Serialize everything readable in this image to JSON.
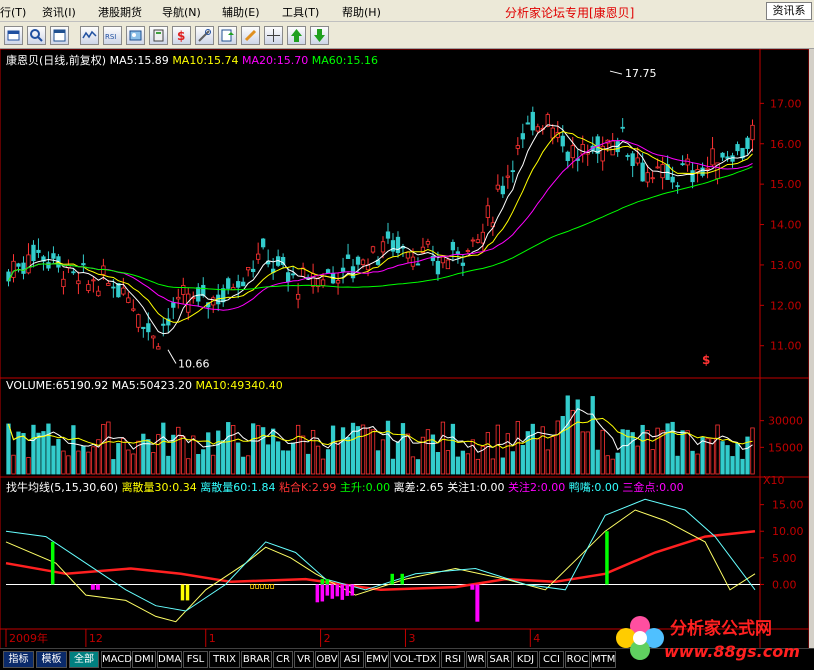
{
  "menu": {
    "items": [
      "行(T)",
      "资讯(I)",
      "港股期货",
      "导航(N)",
      "辅助(E)",
      "工具(T)",
      "帮助(H)"
    ],
    "brand": "分析家论坛专用[康恩贝]",
    "info_button": "资讯系"
  },
  "colors": {
    "up": "#ff3333",
    "down": "#33cccc",
    "ma5": "#ffffff",
    "ma10": "#ffff00",
    "ma20": "#ff00ff",
    "ma60": "#00ff00"
  },
  "price_panel": {
    "title": "康恩贝(日线,前复权)",
    "ma5": "MA5:15.89",
    "ma10": "MA10:15.74",
    "ma20": "MA20:15.70",
    "ma60": "MA60:15.16",
    "high_label": "17.75",
    "low_label": "10.66",
    "axis_ticks": [
      "17.00",
      "16.00",
      "15.00",
      "14.00",
      "13.00",
      "12.00",
      "11.00"
    ],
    "marker": "$"
  },
  "volume_panel": {
    "volume": "VOLUME:65190.92",
    "ma5": "MA5:50423.20",
    "ma10": "MA10:49340.40",
    "axis_ticks": [
      "30000",
      "15000"
    ],
    "unit": "X10"
  },
  "indicator_panel": {
    "name": "找牛均线(5,15,30,60)",
    "values": [
      {
        "text": "离散量30:0.34",
        "color": "#ffff00"
      },
      {
        "text": "离散量60:1.84",
        "color": "#33ffff"
      },
      {
        "text": "粘合K:2.99",
        "color": "#ff3333"
      },
      {
        "text": "主升:0.00",
        "color": "#00ff00"
      },
      {
        "text": "离差:2.65",
        "color": "#ffffff"
      },
      {
        "text": "关注1:0.00",
        "color": "#ffffff"
      },
      {
        "text": "关注2:0.00",
        "color": "#ff00ff"
      },
      {
        "text": "鸭嘴:0.00",
        "color": "#33ffff"
      },
      {
        "text": "三金点:0.00",
        "color": "#ff00ff"
      }
    ],
    "axis_ticks": [
      "15.00",
      "10.00",
      "5.00",
      "0.00"
    ]
  },
  "time_axis": {
    "labels": [
      "2009年",
      "12",
      "1",
      "2",
      "3",
      "4"
    ]
  },
  "tabs": {
    "indicator_tabs": [
      "指标",
      "模板"
    ],
    "selected": "全部",
    "items": [
      "MACD",
      "DMI",
      "DMA",
      "FSL",
      "TRIX",
      "BRAR",
      "CR",
      "VR",
      "OBV",
      "ASI",
      "EMV",
      "VOL-TDX",
      "RSI",
      "WR",
      "SAR",
      "KDJ",
      "CCI",
      "ROC",
      "MTM"
    ]
  },
  "watermark": {
    "title": "分析家公式网",
    "url": "www.88gs.com"
  }
}
